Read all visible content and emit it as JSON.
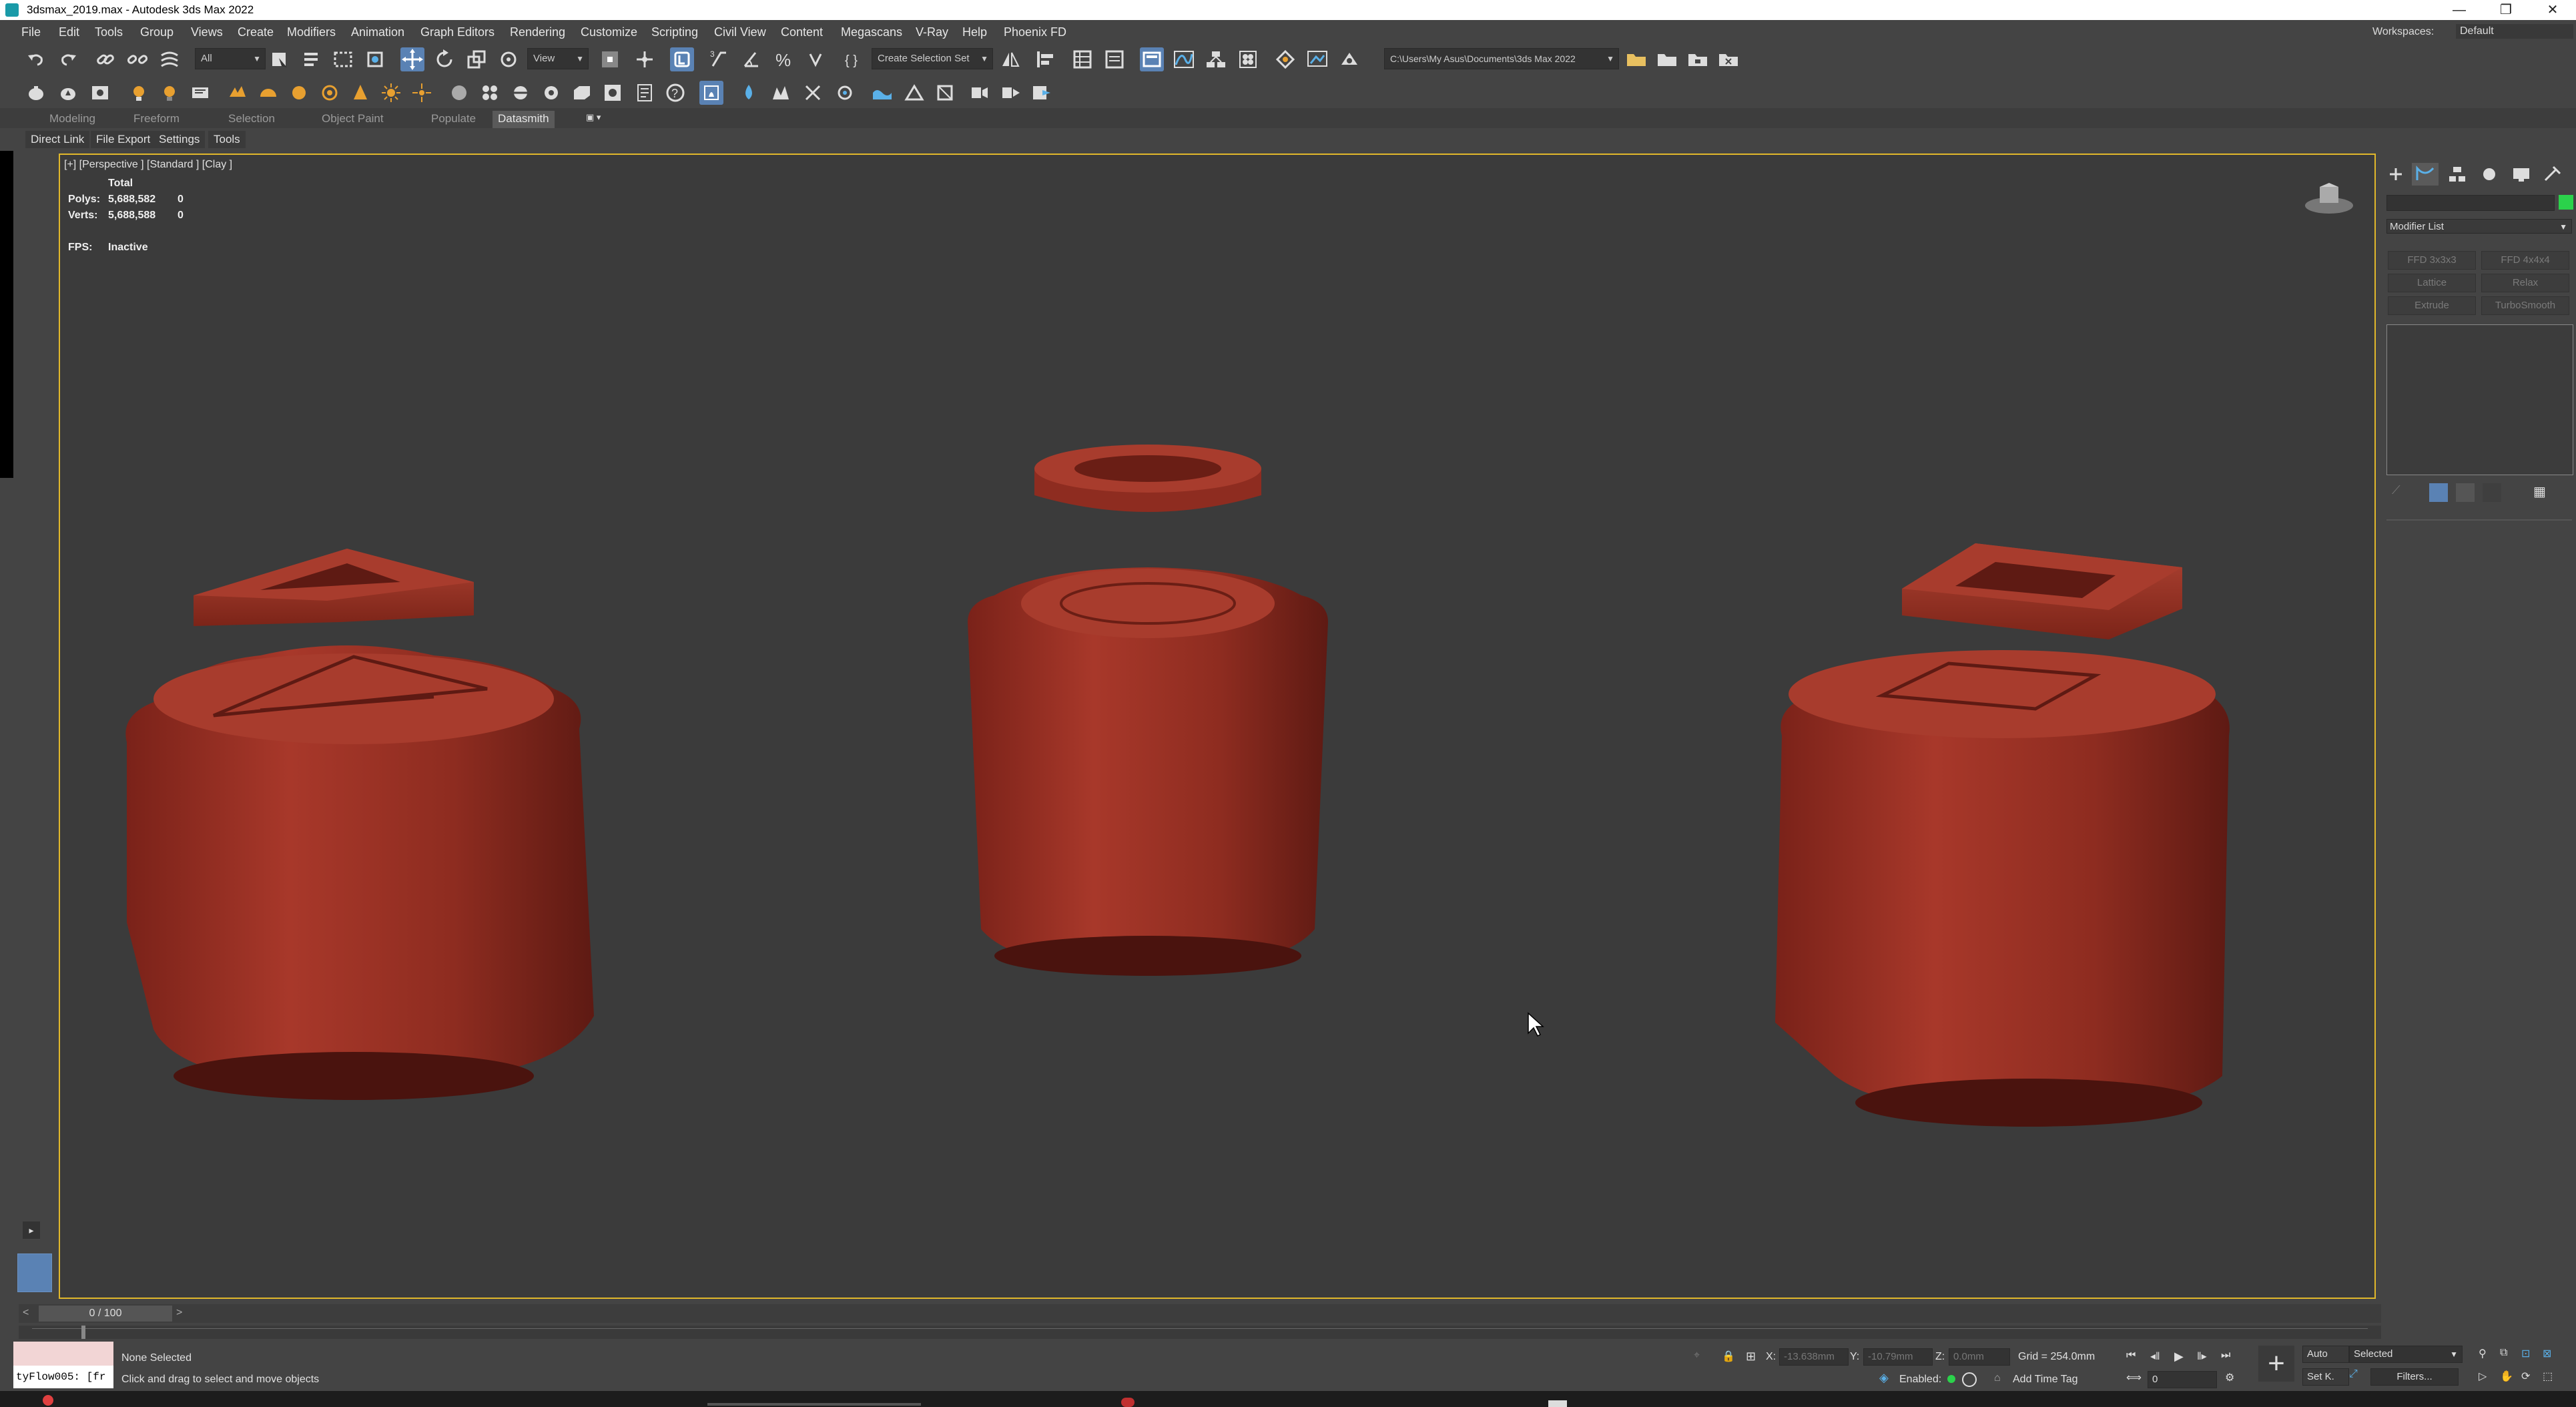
{
  "window": {
    "title": "3dsmax_2019.max - Autodesk 3ds Max 2022",
    "minimize": "—",
    "maximize": "❐",
    "close": "✕"
  },
  "menubar": {
    "items": [
      "File",
      "Edit",
      "Tools",
      "Group",
      "Views",
      "Create",
      "Modifiers",
      "Animation",
      "Graph Editors",
      "Rendering",
      "Customize",
      "Scripting",
      "Civil View",
      "Content",
      "Megascans",
      "V-Ray",
      "Help",
      "Phoenix FD"
    ],
    "workspace_label": "Workspaces:",
    "workspace_value": "Default"
  },
  "toolbar": {
    "filter_value": "All",
    "ref_coord_value": "View",
    "selection_set_placeholder": "Create Selection Set",
    "project_path": "C:\\Users\\My Asus\\Documents\\3ds Max 2022"
  },
  "ribbon": {
    "tabs": [
      "Modeling",
      "Freeform",
      "Selection",
      "Object Paint",
      "Populate",
      "Datasmith"
    ],
    "active_tab": "Datasmith",
    "datasmith_items": [
      "Direct Link",
      "File Export",
      "Settings",
      "Tools"
    ]
  },
  "viewport": {
    "label": "[+] [Perspective ] [Standard ] [Clay ]",
    "stats_header": "Total",
    "polys_label": "Polys:",
    "polys_value": "5,688,582",
    "polys_sel": "0",
    "verts_label": "Verts:",
    "verts_value": "5,688,588",
    "verts_sel": "0",
    "fps_label": "FPS:",
    "fps_value": "Inactive",
    "clay_color": "#9c2f22",
    "border_color": "#e1b82b"
  },
  "command_panel": {
    "modifier_list": "Modifier List",
    "object_color": "#2bd24b",
    "modifier_buttons": [
      "FFD 3x3x3",
      "FFD 4x4x4",
      "Lattice",
      "Relax",
      "Extrude",
      "TurboSmooth"
    ]
  },
  "timeline": {
    "frame_label": "0 / 100",
    "prev": "<",
    "next": ">"
  },
  "status": {
    "script_listener": "tyFlow005: [fr",
    "selection": "None Selected",
    "prompt": "Click and drag to select and move objects",
    "x_label": "X:",
    "x_value": "-13.638mm",
    "y_label": "Y:",
    "y_value": "-10.79mm",
    "z_label": "Z:",
    "z_value": "0.0mm",
    "grid": "Grid = 254.0mm",
    "enabled_label": "Enabled:",
    "add_time_tag": "Add Time Tag",
    "auto_key": "Auto",
    "set_key": "Set K.",
    "key_mode": "Selected",
    "filters": "Filters...",
    "frame_value": "0"
  }
}
